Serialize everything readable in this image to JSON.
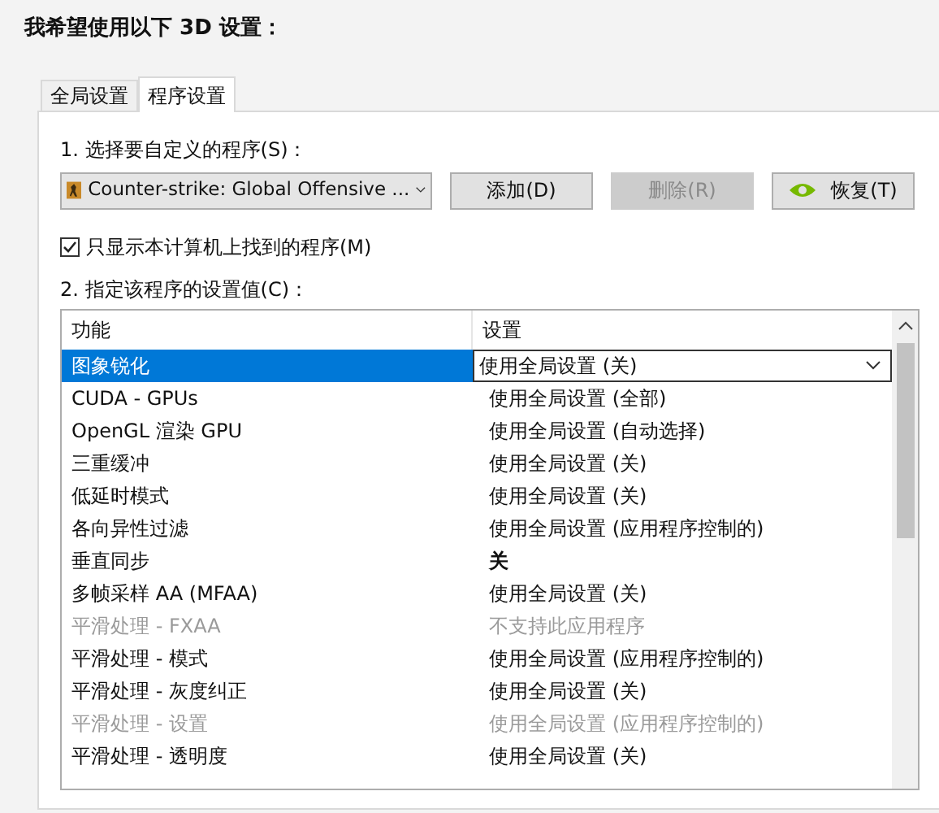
{
  "heading": "我希望使用以下 3D 设置：",
  "tabs": [
    {
      "label": "全局设置",
      "selected": false
    },
    {
      "label": "程序设置",
      "selected": true
    }
  ],
  "program_label": "1. 选择要自定义的程序(S)：",
  "program_select": {
    "value": "Counter-strike: Global Offensive ..."
  },
  "buttons": [
    {
      "label": "添加(D)",
      "disabled": false,
      "kind": "plain"
    },
    {
      "label": "删除(R)",
      "disabled": true,
      "kind": "plain"
    },
    {
      "label": "恢复(T)",
      "disabled": false,
      "kind": "logo"
    }
  ],
  "filter_checkbox": {
    "label": "只显示本计算机上找到的程序(M)",
    "checked": true
  },
  "settings_label": "2. 指定该程序的设置值(C)：",
  "table": {
    "columns": [
      "功能",
      "设置"
    ],
    "rows": [
      {
        "feature": "图象锐化",
        "setting": "使用全局设置 (关)",
        "selected": true,
        "disabled": false,
        "modified": false
      },
      {
        "feature": "CUDA - GPUs",
        "setting": "使用全局设置 (全部)",
        "selected": false,
        "disabled": false,
        "modified": false
      },
      {
        "feature": "OpenGL 渲染 GPU",
        "setting": "使用全局设置 (自动选择)",
        "selected": false,
        "disabled": false,
        "modified": false
      },
      {
        "feature": "三重缓冲",
        "setting": "使用全局设置 (关)",
        "selected": false,
        "disabled": false,
        "modified": false
      },
      {
        "feature": "低延时模式",
        "setting": "使用全局设置 (关)",
        "selected": false,
        "disabled": false,
        "modified": false
      },
      {
        "feature": "各向异性过滤",
        "setting": "使用全局设置 (应用程序控制的)",
        "selected": false,
        "disabled": false,
        "modified": false
      },
      {
        "feature": "垂直同步",
        "setting": "关",
        "selected": false,
        "disabled": false,
        "modified": true
      },
      {
        "feature": "多帧采样 AA (MFAA)",
        "setting": "使用全局设置 (关)",
        "selected": false,
        "disabled": false,
        "modified": false
      },
      {
        "feature": "平滑处理 - FXAA",
        "setting": "不支持此应用程序",
        "selected": false,
        "disabled": true,
        "modified": false
      },
      {
        "feature": "平滑处理 - 模式",
        "setting": "使用全局设置 (应用程序控制的)",
        "selected": false,
        "disabled": false,
        "modified": false
      },
      {
        "feature": "平滑处理 - 灰度纠正",
        "setting": "使用全局设置 (关)",
        "selected": false,
        "disabled": false,
        "modified": false
      },
      {
        "feature": "平滑处理 - 设置",
        "setting": "使用全局设置 (应用程序控制的)",
        "selected": false,
        "disabled": true,
        "modified": false
      },
      {
        "feature": "平滑处理 - 透明度",
        "setting": "使用全局设置 (关)",
        "selected": false,
        "disabled": false,
        "modified": false
      }
    ]
  }
}
